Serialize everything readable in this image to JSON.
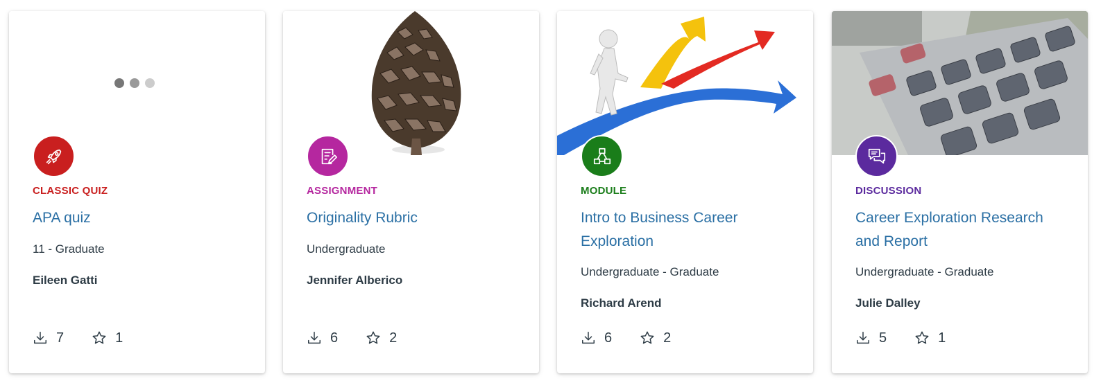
{
  "cards": [
    {
      "type_label": "CLASSIC QUIZ",
      "type_color": "#c91f1f",
      "icon": "rocket-icon",
      "title": "APA quiz",
      "meta": "11 - Graduate",
      "author": "Eileen Gatti",
      "downloads": "7",
      "favorites": "1",
      "image": "loading-dots"
    },
    {
      "type_label": "ASSIGNMENT",
      "type_color": "#b5279f",
      "icon": "assignment-icon",
      "title": "Originality Rubric",
      "meta": "Undergraduate",
      "author": "Jennifer Alberico",
      "downloads": "6",
      "favorites": "2",
      "image": "pinecone-image"
    },
    {
      "type_label": "MODULE",
      "type_color": "#1a7d1a",
      "icon": "module-icon",
      "title": "Intro to Business Career Exploration",
      "meta": "Undergraduate - Graduate",
      "author": "Richard Arend",
      "downloads": "6",
      "favorites": "2",
      "image": "career-path-arrows-image"
    },
    {
      "type_label": "DISCUSSION",
      "type_color": "#5b2a9e",
      "icon": "discussion-icon",
      "title": "Career Exploration Research and Report",
      "meta": "Undergraduate - Graduate",
      "author": "Julie Dalley",
      "downloads": "5",
      "favorites": "1",
      "image": "calculator-image"
    }
  ]
}
